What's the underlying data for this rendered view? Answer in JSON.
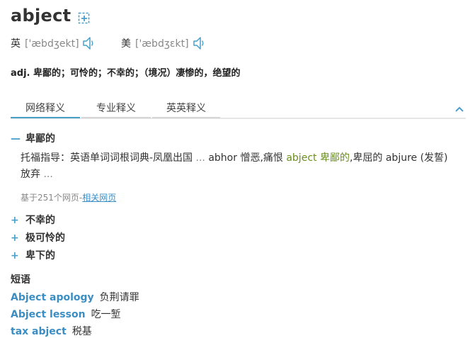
{
  "entry": {
    "word": "abject",
    "uk": {
      "label": "英",
      "ipa": "['æbdʒekt]"
    },
    "us": {
      "label": "美",
      "ipa": "['æbdʒɛkt]"
    },
    "definition": "adj. 卑鄙的；可怜的；不幸的；（境况）凄惨的，绝望的"
  },
  "tabs": [
    "网络释义",
    "专业释义",
    "英英释义"
  ],
  "web_sense": {
    "title": "卑鄙的",
    "example_pre": "托福指导：英语单词词根词典-凤凰出国",
    "example_ellipsis1": " ... ",
    "example_mid": "abhor 憎恶,痛恨 ",
    "example_highlight": "abject 卑鄙的",
    "example_post": ",卑屈的 abjure (发誓)放弃",
    "example_ellipsis2": " ...",
    "source_prefix": "基于251个网页-",
    "source_link": "相关网页"
  },
  "collapsed_senses": [
    "不幸的",
    "极可怜的",
    "卑下的"
  ],
  "phrases": {
    "heading": "短语",
    "items": [
      {
        "en": "Abject apology",
        "zh": "负荆请罪"
      },
      {
        "en": "Abject lesson",
        "zh": "吃一堑"
      },
      {
        "en": "tax abject",
        "zh": "税基"
      }
    ]
  },
  "colors": {
    "accent": "#4a9fc8",
    "link": "#3b8ec4",
    "highlight": "#6a8e1f"
  },
  "icons": [
    "add-to-wordbook-icon",
    "speaker-icon",
    "chevron-up-icon",
    "minus-icon",
    "plus-icon"
  ]
}
